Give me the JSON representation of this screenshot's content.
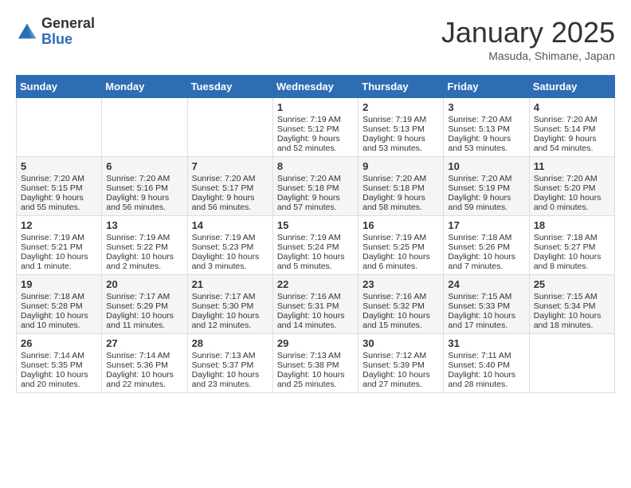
{
  "header": {
    "logo_general": "General",
    "logo_blue": "Blue",
    "month": "January 2025",
    "location": "Masuda, Shimane, Japan"
  },
  "weekdays": [
    "Sunday",
    "Monday",
    "Tuesday",
    "Wednesday",
    "Thursday",
    "Friday",
    "Saturday"
  ],
  "weeks": [
    [
      {
        "day": "",
        "info": ""
      },
      {
        "day": "",
        "info": ""
      },
      {
        "day": "",
        "info": ""
      },
      {
        "day": "1",
        "info": "Sunrise: 7:19 AM\nSunset: 5:12 PM\nDaylight: 9 hours\nand 52 minutes."
      },
      {
        "day": "2",
        "info": "Sunrise: 7:19 AM\nSunset: 5:13 PM\nDaylight: 9 hours\nand 53 minutes."
      },
      {
        "day": "3",
        "info": "Sunrise: 7:20 AM\nSunset: 5:13 PM\nDaylight: 9 hours\nand 53 minutes."
      },
      {
        "day": "4",
        "info": "Sunrise: 7:20 AM\nSunset: 5:14 PM\nDaylight: 9 hours\nand 54 minutes."
      }
    ],
    [
      {
        "day": "5",
        "info": "Sunrise: 7:20 AM\nSunset: 5:15 PM\nDaylight: 9 hours\nand 55 minutes."
      },
      {
        "day": "6",
        "info": "Sunrise: 7:20 AM\nSunset: 5:16 PM\nDaylight: 9 hours\nand 56 minutes."
      },
      {
        "day": "7",
        "info": "Sunrise: 7:20 AM\nSunset: 5:17 PM\nDaylight: 9 hours\nand 56 minutes."
      },
      {
        "day": "8",
        "info": "Sunrise: 7:20 AM\nSunset: 5:18 PM\nDaylight: 9 hours\nand 57 minutes."
      },
      {
        "day": "9",
        "info": "Sunrise: 7:20 AM\nSunset: 5:18 PM\nDaylight: 9 hours\nand 58 minutes."
      },
      {
        "day": "10",
        "info": "Sunrise: 7:20 AM\nSunset: 5:19 PM\nDaylight: 9 hours\nand 59 minutes."
      },
      {
        "day": "11",
        "info": "Sunrise: 7:20 AM\nSunset: 5:20 PM\nDaylight: 10 hours\nand 0 minutes."
      }
    ],
    [
      {
        "day": "12",
        "info": "Sunrise: 7:19 AM\nSunset: 5:21 PM\nDaylight: 10 hours\nand 1 minute."
      },
      {
        "day": "13",
        "info": "Sunrise: 7:19 AM\nSunset: 5:22 PM\nDaylight: 10 hours\nand 2 minutes."
      },
      {
        "day": "14",
        "info": "Sunrise: 7:19 AM\nSunset: 5:23 PM\nDaylight: 10 hours\nand 3 minutes."
      },
      {
        "day": "15",
        "info": "Sunrise: 7:19 AM\nSunset: 5:24 PM\nDaylight: 10 hours\nand 5 minutes."
      },
      {
        "day": "16",
        "info": "Sunrise: 7:19 AM\nSunset: 5:25 PM\nDaylight: 10 hours\nand 6 minutes."
      },
      {
        "day": "17",
        "info": "Sunrise: 7:18 AM\nSunset: 5:26 PM\nDaylight: 10 hours\nand 7 minutes."
      },
      {
        "day": "18",
        "info": "Sunrise: 7:18 AM\nSunset: 5:27 PM\nDaylight: 10 hours\nand 8 minutes."
      }
    ],
    [
      {
        "day": "19",
        "info": "Sunrise: 7:18 AM\nSunset: 5:28 PM\nDaylight: 10 hours\nand 10 minutes."
      },
      {
        "day": "20",
        "info": "Sunrise: 7:17 AM\nSunset: 5:29 PM\nDaylight: 10 hours\nand 11 minutes."
      },
      {
        "day": "21",
        "info": "Sunrise: 7:17 AM\nSunset: 5:30 PM\nDaylight: 10 hours\nand 12 minutes."
      },
      {
        "day": "22",
        "info": "Sunrise: 7:16 AM\nSunset: 5:31 PM\nDaylight: 10 hours\nand 14 minutes."
      },
      {
        "day": "23",
        "info": "Sunrise: 7:16 AM\nSunset: 5:32 PM\nDaylight: 10 hours\nand 15 minutes."
      },
      {
        "day": "24",
        "info": "Sunrise: 7:15 AM\nSunset: 5:33 PM\nDaylight: 10 hours\nand 17 minutes."
      },
      {
        "day": "25",
        "info": "Sunrise: 7:15 AM\nSunset: 5:34 PM\nDaylight: 10 hours\nand 18 minutes."
      }
    ],
    [
      {
        "day": "26",
        "info": "Sunrise: 7:14 AM\nSunset: 5:35 PM\nDaylight: 10 hours\nand 20 minutes."
      },
      {
        "day": "27",
        "info": "Sunrise: 7:14 AM\nSunset: 5:36 PM\nDaylight: 10 hours\nand 22 minutes."
      },
      {
        "day": "28",
        "info": "Sunrise: 7:13 AM\nSunset: 5:37 PM\nDaylight: 10 hours\nand 23 minutes."
      },
      {
        "day": "29",
        "info": "Sunrise: 7:13 AM\nSunset: 5:38 PM\nDaylight: 10 hours\nand 25 minutes."
      },
      {
        "day": "30",
        "info": "Sunrise: 7:12 AM\nSunset: 5:39 PM\nDaylight: 10 hours\nand 27 minutes."
      },
      {
        "day": "31",
        "info": "Sunrise: 7:11 AM\nSunset: 5:40 PM\nDaylight: 10 hours\nand 28 minutes."
      },
      {
        "day": "",
        "info": ""
      }
    ]
  ]
}
